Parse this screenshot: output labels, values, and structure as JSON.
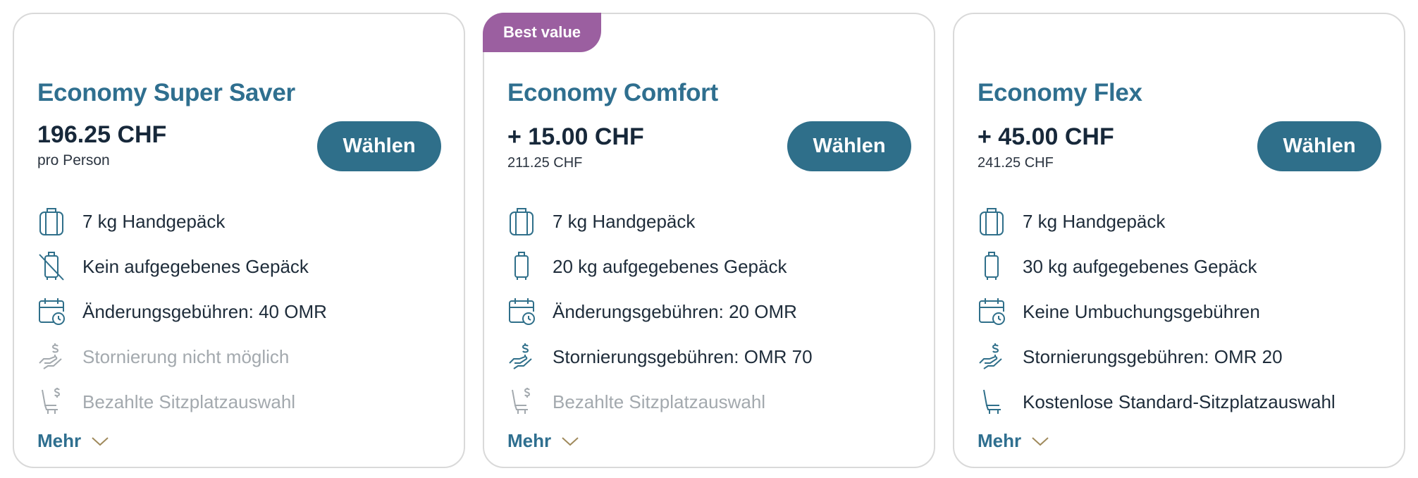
{
  "colors": {
    "title": "#2f6f8f",
    "button": "#2f6f8a",
    "badge": "#9b5fa0",
    "muted": "#a3a9ae",
    "chevron": "#a08a5c"
  },
  "cards": [
    {
      "title": "Economy Super Saver",
      "price": "196.25 CHF",
      "sub": "pro Person",
      "button": "Wählen",
      "more": "Mehr",
      "features": [
        {
          "icon": "carry-on-bag-icon",
          "text": "7 kg Handgepäck",
          "muted": false
        },
        {
          "icon": "no-checked-bag-icon",
          "text": "Kein aufgegebenes Gepäck",
          "muted": false
        },
        {
          "icon": "calendar-clock-icon",
          "text": "Änderungsgebühren: 40 OMR",
          "muted": false
        },
        {
          "icon": "refund-hand-icon",
          "text": "Stornierung nicht möglich",
          "muted": true
        },
        {
          "icon": "seat-dollar-icon",
          "text": "Bezahlte Sitzplatzauswahl",
          "muted": true
        }
      ]
    },
    {
      "badge": "Best value",
      "title": "Economy Comfort",
      "price": "+ 15.00 CHF",
      "sub": "211.25 CHF",
      "button": "Wählen",
      "more": "Mehr",
      "features": [
        {
          "icon": "carry-on-bag-icon",
          "text": "7 kg Handgepäck",
          "muted": false
        },
        {
          "icon": "checked-bag-icon",
          "text": "20 kg aufgegebenes Gepäck",
          "muted": false
        },
        {
          "icon": "calendar-clock-icon",
          "text": "Änderungsgebühren: 20 OMR",
          "muted": false
        },
        {
          "icon": "refund-hand-icon",
          "text": "Stornierungsgebühren: OMR 70",
          "muted": false
        },
        {
          "icon": "seat-dollar-icon",
          "text": "Bezahlte Sitzplatzauswahl",
          "muted": true
        }
      ]
    },
    {
      "title": "Economy Flex",
      "price": "+ 45.00 CHF",
      "sub": "241.25 CHF",
      "button": "Wählen",
      "more": "Mehr",
      "features": [
        {
          "icon": "carry-on-bag-icon",
          "text": "7 kg Handgepäck",
          "muted": false
        },
        {
          "icon": "checked-bag-icon",
          "text": "30 kg aufgegebenes Gepäck",
          "muted": false
        },
        {
          "icon": "calendar-clock-icon",
          "text": "Keine Umbuchungsgebühren",
          "muted": false
        },
        {
          "icon": "refund-hand-icon",
          "text": "Stornierungsgebühren: OMR 20",
          "muted": false
        },
        {
          "icon": "seat-icon",
          "text": "Kostenlose Standard-Sitzplatzauswahl",
          "muted": false
        }
      ]
    }
  ]
}
